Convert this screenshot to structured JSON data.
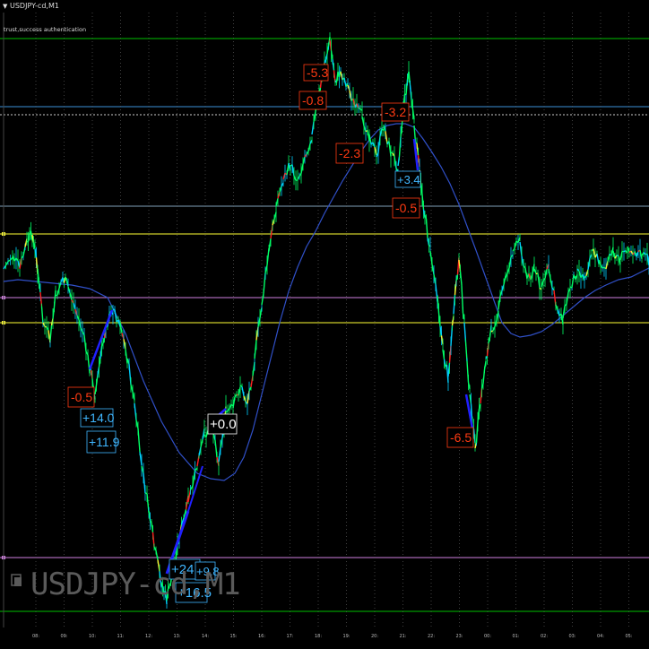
{
  "window": {
    "title": "USDJPY-cd,M1",
    "subtitle": "trust,success authentication",
    "watermark": "USDJPY-cd,M1"
  },
  "colors": {
    "background": "#000000",
    "green_line": "#00c000",
    "blue_line": "#3b8fd8",
    "gray_line": "#7fa0b8",
    "yellow_line": "#ffff33",
    "violet_line": "#d080e0",
    "ma_line": "#3050c8",
    "price_up": "#00ff66",
    "price_down": "#ff2020",
    "price_mid": "#00d0ff",
    "trend_blue": "#2020ff",
    "label_red": "#ff3a12",
    "label_blue": "#3fb6ff"
  },
  "icons": [
    "dropdown-arrow-icon",
    "chart-object-icon"
  ],
  "time_axis_labels": [
    "08:",
    "09:",
    "10:",
    "11:",
    "12:",
    "13:",
    "14:",
    "15:",
    "16:",
    "17:",
    "18:",
    "19:",
    "20:",
    "21:",
    "22:",
    "23:",
    "00:",
    "01:",
    "02:",
    "03:",
    "04:",
    "05:"
  ],
  "trade_labels": [
    {
      "text": "-5.3",
      "type": "loss"
    },
    {
      "text": "-0.8",
      "type": "loss"
    },
    {
      "text": "-3.2",
      "type": "loss"
    },
    {
      "text": "-2.3",
      "type": "loss"
    },
    {
      "text": "+3.4",
      "type": "profit"
    },
    {
      "text": "-0.5",
      "type": "loss"
    },
    {
      "text": "-0.5",
      "type": "loss"
    },
    {
      "text": "+14.0",
      "type": "profit"
    },
    {
      "text": "+11.9",
      "type": "profit"
    },
    {
      "text": "+0.0",
      "type": "profit"
    },
    {
      "text": "-6.5",
      "type": "loss"
    },
    {
      "text": "+24.4",
      "type": "profit"
    },
    {
      "text": "+9.8",
      "type": "profit"
    },
    {
      "text": "+16.5",
      "type": "profit"
    }
  ]
}
